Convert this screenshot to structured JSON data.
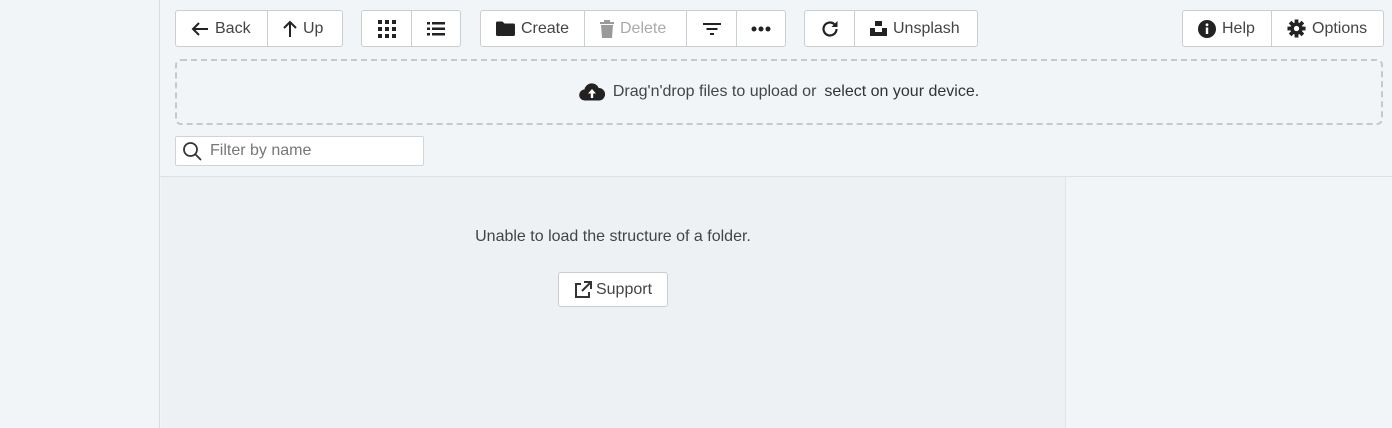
{
  "toolbar": {
    "back_label": "Back",
    "up_label": "Up",
    "create_label": "Create",
    "delete_label": "Delete",
    "unsplash_label": "Unsplash",
    "help_label": "Help",
    "options_label": "Options"
  },
  "upload": {
    "text": "Drag'n'drop files to upload or",
    "link": "select on your device."
  },
  "filter": {
    "placeholder": "Filter by name",
    "value": ""
  },
  "content": {
    "error_message": "Unable to load the structure of a folder.",
    "support_label": "Support"
  },
  "icons": {
    "back": "arrow-left-icon",
    "up": "arrow-up-icon",
    "grid": "grid-view-icon",
    "list": "list-view-icon",
    "create": "folder-icon",
    "delete": "trash-icon",
    "sort": "filter-sort-icon",
    "more": "more-dots-icon",
    "refresh": "refresh-icon",
    "unsplash": "unsplash-icon",
    "help": "info-icon",
    "options": "gear-icon",
    "upload": "cloud-upload-icon",
    "search": "search-icon",
    "external": "external-link-icon"
  },
  "colors": {
    "background": "#f2f5f8",
    "content_background": "#edf1f4",
    "disabled_text": "#aaaaaa"
  }
}
